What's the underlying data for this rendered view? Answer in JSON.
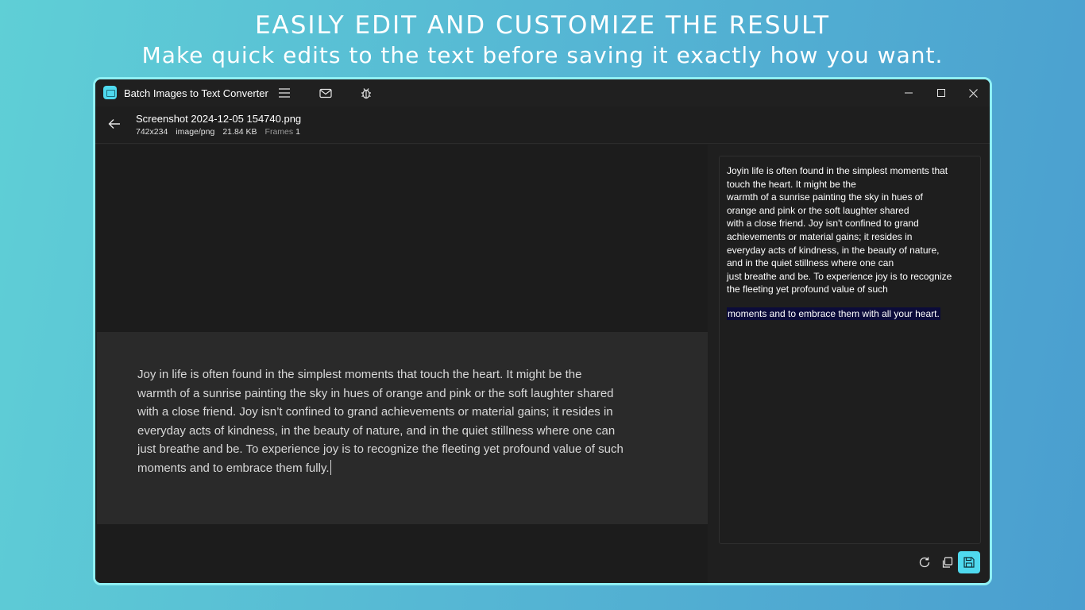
{
  "hero": {
    "title": "EASILY EDIT AND CUSTOMIZE THE RESULT",
    "subtitle": "Make quick edits to the text before saving it exactly how you want."
  },
  "window": {
    "app_title": "Batch Images to Text Converter",
    "toolbar_icons": [
      "menu-icon",
      "mail-icon",
      "bug-icon"
    ],
    "controls": [
      "minimize-icon",
      "maximize-icon",
      "close-icon"
    ]
  },
  "file": {
    "name": "Screenshot 2024-12-05 154740.png",
    "dimensions": "742x234",
    "mime": "image/png",
    "size": "21.84 KB",
    "frames_label": "Frames",
    "frames_value": "1"
  },
  "preview": {
    "text": "Joy in life is often found in the simplest moments that touch the heart. It might be the\nwarmth of a sunrise painting the sky in hues of orange and pink or the soft laughter shared\nwith a close friend. Joy isn’t confined to grand achievements or material gains; it resides in\neveryday acts of kindness, in the beauty of nature, and in the quiet stillness where one can\njust breathe and be. To experience joy is to recognize the fleeting yet profound value of such\nmoments and to embrace them fully."
  },
  "editor": {
    "text": "Joyin life is often found in the simplest moments that\ntouch the heart. It might be the\nwarmth of a sunrise painting the sky in hues of\norange and pink or the soft laughter shared\nwith a close friend. Joy isn't confined to grand\nachievements or material gains; it resides in\neveryday acts of kindness, in the beauty of nature,\nand in the quiet stillness where one can\njust breathe and be. To experience joy is to recognize\nthe fleeting yet profound value of such",
    "selected_text": "moments and to embrace them with all your heart."
  },
  "actions": [
    "refresh-icon",
    "copy-icon",
    "save-icon"
  ],
  "colors": {
    "accent": "#4fd9ee",
    "window_border": "#8ff0f4",
    "selection": "#0b0b3a"
  }
}
